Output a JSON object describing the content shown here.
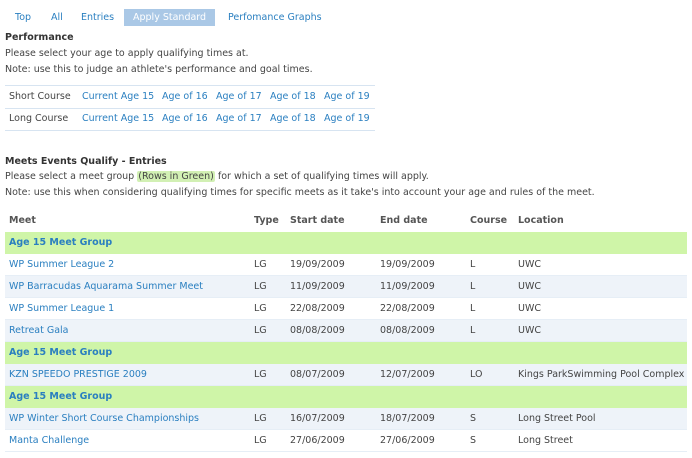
{
  "tabs": [
    "Top",
    "All",
    "Entries",
    "Apply Standard",
    "Perfomance Graphs"
  ],
  "performance": {
    "title": "Performance",
    "line1": "Please select your age to apply qualifying times at.",
    "line2": "Note: use this to judge an athlete's performance and goal times.",
    "rows": [
      {
        "label": "Short Course",
        "links": [
          "Current Age 15",
          "Age of 16",
          "Age of 17",
          "Age of 18",
          "Age of 19"
        ]
      },
      {
        "label": "Long Course",
        "links": [
          "Current Age 15",
          "Age of 16",
          "Age of 17",
          "Age of 18",
          "Age of 19"
        ]
      }
    ]
  },
  "meets": {
    "title": "Meets Events Qualify - Entries",
    "line1_before": "Please select a meet group ",
    "line1_highlight": "(Rows in Green)",
    "line1_after": " for which a set of qualifying times will apply.",
    "line2": "Note: use this when considering qualifying times for specific meets as it take's into account your age and rules of the meet.",
    "headers": {
      "meet": "Meet",
      "type": "Type",
      "start": "Start date",
      "end": "End date",
      "course": "Course",
      "location": "Location"
    },
    "rows": [
      {
        "kind": "group",
        "meet": "Age 15 Meet Group"
      },
      {
        "kind": "meet",
        "meet": "WP Summer League 2",
        "type": "LG",
        "start": "19/09/2009",
        "end": "19/09/2009",
        "course": "L",
        "location": "UWC"
      },
      {
        "kind": "meet",
        "meet": "WP Barracudas Aquarama Summer Meet",
        "type": "LG",
        "start": "11/09/2009",
        "end": "11/09/2009",
        "course": "L",
        "location": "UWC"
      },
      {
        "kind": "meet",
        "meet": "WP Summer League 1",
        "type": "LG",
        "start": "22/08/2009",
        "end": "22/08/2009",
        "course": "L",
        "location": "UWC"
      },
      {
        "kind": "meet",
        "meet": "Retreat Gala",
        "type": "LG",
        "start": "08/08/2009",
        "end": "08/08/2009",
        "course": "L",
        "location": "UWC"
      },
      {
        "kind": "group",
        "meet": "Age 15 Meet Group"
      },
      {
        "kind": "meet",
        "meet": "KZN SPEEDO PRESTIGE 2009",
        "type": "LG",
        "start": "08/07/2009",
        "end": "12/07/2009",
        "course": "LO",
        "location": "Kings ParkSwimming Pool Complex"
      },
      {
        "kind": "group",
        "meet": "Age 15 Meet Group"
      },
      {
        "kind": "meet",
        "meet": "WP Winter Short Course Championships",
        "type": "LG",
        "start": "16/07/2009",
        "end": "18/07/2009",
        "course": "S",
        "location": "Long Street Pool"
      },
      {
        "kind": "meet",
        "meet": "Manta Challenge",
        "type": "LG",
        "start": "27/06/2009",
        "end": "27/06/2009",
        "course": "S",
        "location": "Long Street"
      }
    ]
  },
  "colors": {
    "link": "#2a7fc0",
    "active_tab_bg": "#aac8e6",
    "group_row_bg": "#cff5a8",
    "alt_row_bg": "#eef3f9",
    "highlight_bg": "#d2f0b4"
  }
}
